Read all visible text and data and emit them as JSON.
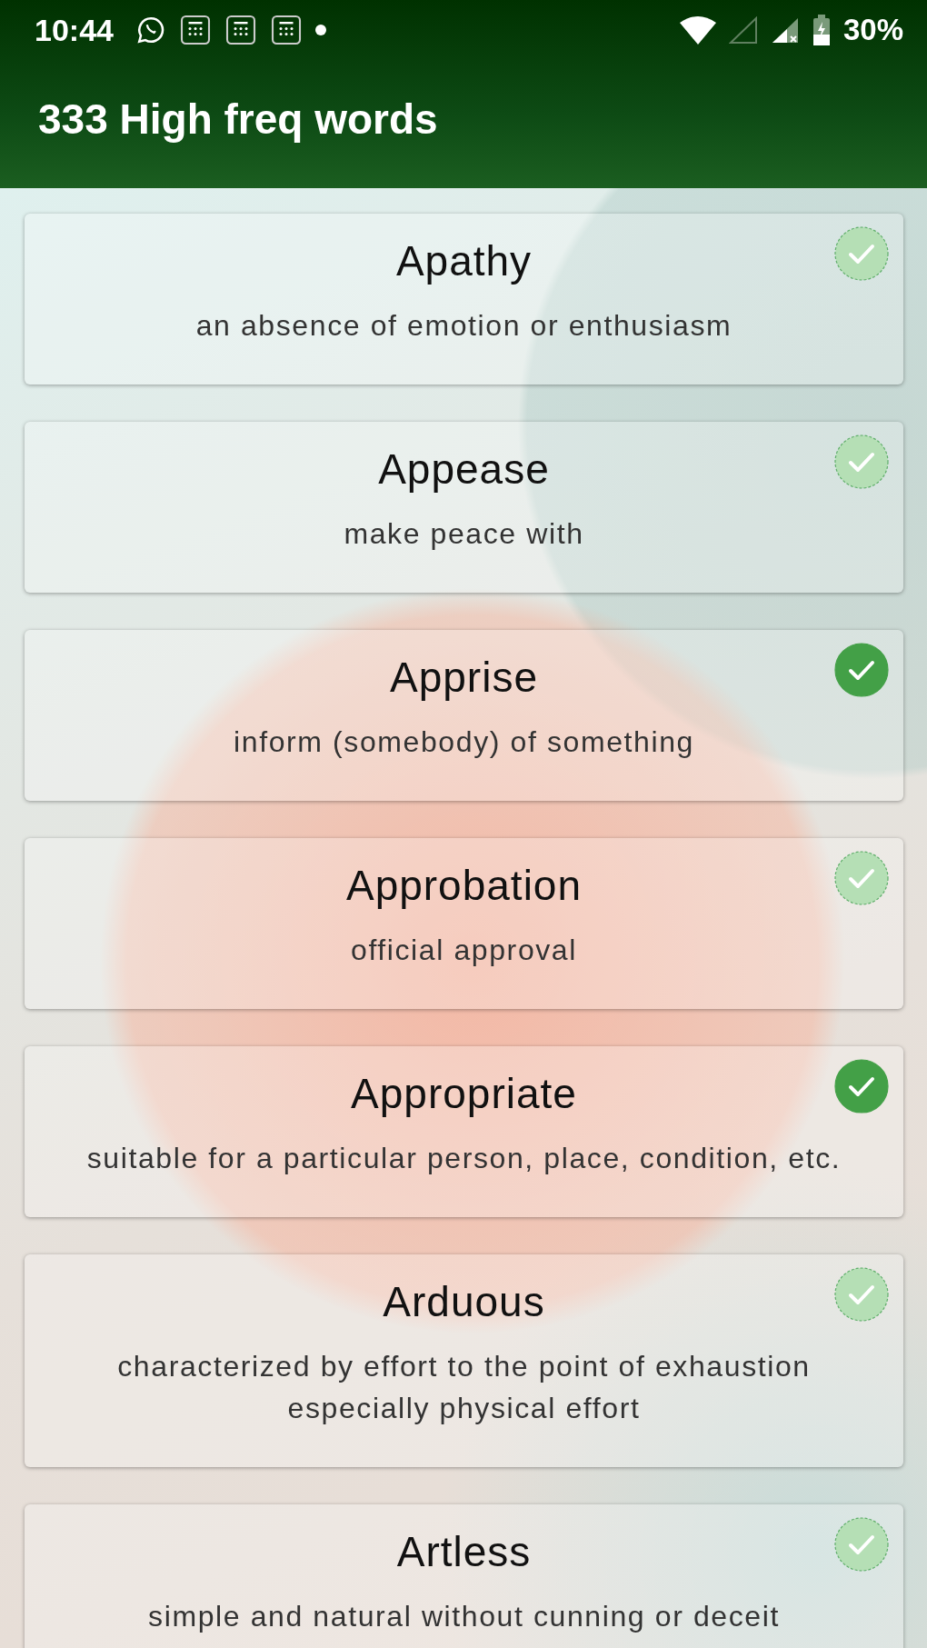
{
  "status_bar": {
    "time": "10:44",
    "battery": "30%"
  },
  "app_bar": {
    "title": "333 High freq words"
  },
  "words": [
    {
      "word": "Apathy",
      "definition": "an absence of emotion or enthusiasm",
      "checked": false
    },
    {
      "word": "Appease",
      "definition": "make peace with",
      "checked": false
    },
    {
      "word": "Apprise",
      "definition": "inform (somebody) of something",
      "checked": true
    },
    {
      "word": "Approbation",
      "definition": "official approval",
      "checked": false
    },
    {
      "word": "Appropriate",
      "definition": "suitable for a particular person, place, condition, etc.",
      "checked": true
    },
    {
      "word": "Arduous",
      "definition": "characterized by effort to the point of exhaustion especially physical effort",
      "checked": false
    },
    {
      "word": "Artless",
      "definition": "simple and natural without cunning or deceit",
      "checked": false
    }
  ]
}
